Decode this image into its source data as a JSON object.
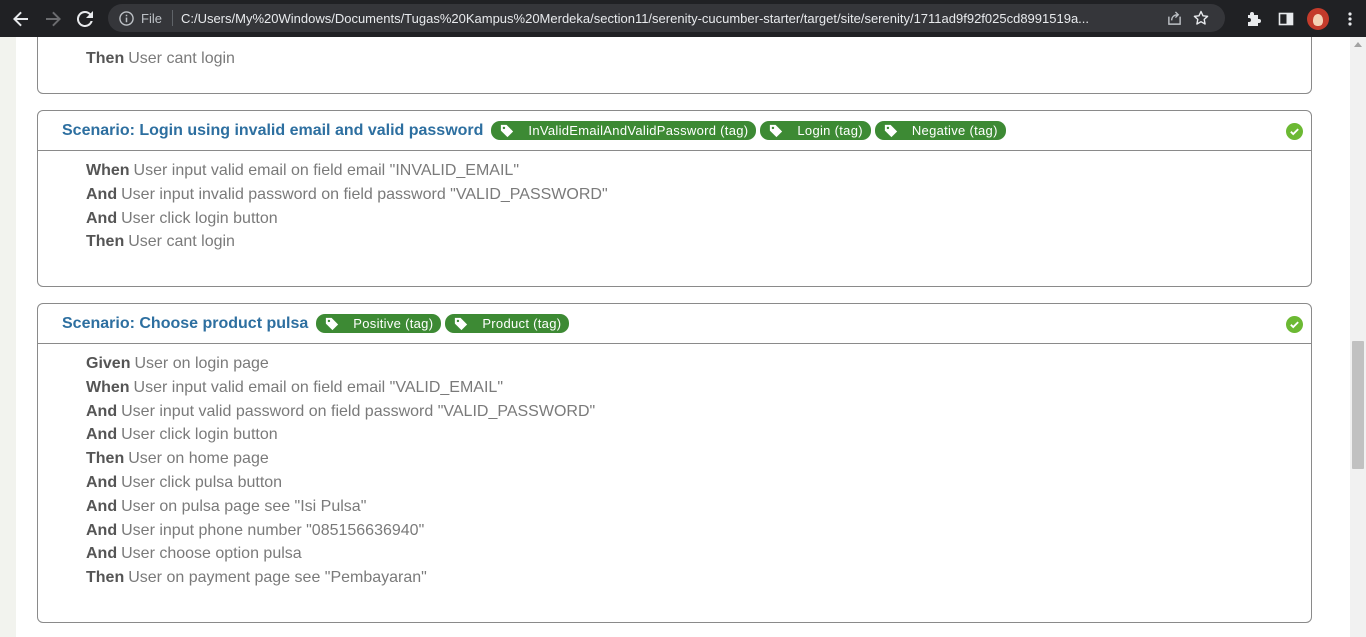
{
  "browser": {
    "file_label": "File",
    "url": "C:/Users/My%20Windows/Documents/Tugas%20Kampus%20Merdeka/section11/serenity-cucumber-starter/target/site/serenity/1711ad9f92f025cd8991519a..."
  },
  "previous_card": {
    "steps": [
      {
        "keyword": "Then",
        "text": "User cant login"
      }
    ]
  },
  "scenarios": [
    {
      "title": "Scenario: Login using invalid email and valid password",
      "tags": [
        "InValidEmailAndValidPassword (tag)",
        "Login (tag)",
        "Negative (tag)"
      ],
      "status": "passed",
      "steps": [
        {
          "keyword": "When",
          "text": "User input valid email on field email \"INVALID_EMAIL\""
        },
        {
          "keyword": "And",
          "text": "User input invalid password on field password \"VALID_PASSWORD\""
        },
        {
          "keyword": "And",
          "text": "User click login button"
        },
        {
          "keyword": "Then",
          "text": "User cant login"
        }
      ]
    },
    {
      "title": "Scenario: Choose product pulsa",
      "tags": [
        "Positive (tag)",
        "Product (tag)"
      ],
      "status": "passed",
      "steps": [
        {
          "keyword": "Given",
          "text": "User on login page"
        },
        {
          "keyword": "When",
          "text": "User input valid email on field email \"VALID_EMAIL\""
        },
        {
          "keyword": "And",
          "text": "User input valid password on field password \"VALID_PASSWORD\""
        },
        {
          "keyword": "And",
          "text": "User click login button"
        },
        {
          "keyword": "Then",
          "text": "User on home page"
        },
        {
          "keyword": "And",
          "text": "User click pulsa button"
        },
        {
          "keyword": "And",
          "text": "User on pulsa page see \"Isi Pulsa\""
        },
        {
          "keyword": "And",
          "text": "User input phone number \"085156636940\""
        },
        {
          "keyword": "And",
          "text": "User choose option pulsa"
        },
        {
          "keyword": "Then",
          "text": "User on payment page see \"Pembayaran\""
        }
      ]
    }
  ],
  "colors": {
    "title": "#2d6fa0",
    "tag_bg": "#3d8a34",
    "check": "#6cb933"
  }
}
